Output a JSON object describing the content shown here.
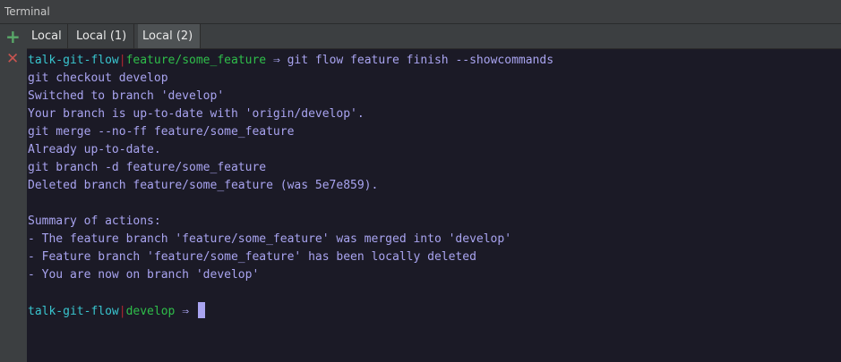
{
  "window": {
    "title": "Terminal"
  },
  "sidebar": {
    "add_icon": "plus-icon",
    "close_icon": "close-icon"
  },
  "tabs": [
    {
      "label": "Local",
      "active": false
    },
    {
      "label": "Local (1)",
      "active": false
    },
    {
      "label": "Local (2)",
      "active": true
    }
  ],
  "terminal": {
    "prompt1": {
      "repo": "talk-git-flow",
      "separator": "|",
      "branch": "feature/some_feature",
      "arrow": "⇒",
      "command": "git flow feature finish --showcommands"
    },
    "output": [
      "git checkout develop",
      "Switched to branch 'develop'",
      "Your branch is up-to-date with 'origin/develop'.",
      "git merge --no-ff feature/some_feature",
      "Already up-to-date.",
      "git branch -d feature/some_feature",
      "Deleted branch feature/some_feature (was 5e7e859).",
      "",
      "Summary of actions:",
      "- The feature branch 'feature/some_feature' was merged into 'develop'",
      "- Feature branch 'feature/some_feature' has been locally deleted",
      "- You are now on branch 'develop'",
      ""
    ],
    "prompt2": {
      "repo": "talk-git-flow",
      "separator": "|",
      "branch": "develop",
      "arrow": "⇒"
    }
  },
  "colors": {
    "repo": "#39c5cf",
    "branch": "#2fbe4a",
    "separator": "#b4282f",
    "text": "#a9a4f0",
    "background": "#1b1a26"
  }
}
